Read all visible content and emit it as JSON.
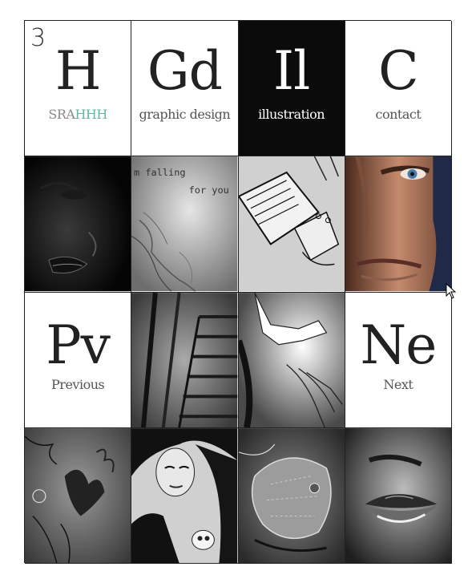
{
  "home_tile": {
    "number": "3",
    "symbol": "H",
    "brand_first": "SRA",
    "brand_second": "HHH"
  },
  "nav": [
    {
      "symbol": "Gd",
      "label": "graphic design"
    },
    {
      "symbol": "Il",
      "label": "illustration"
    },
    {
      "symbol": "C",
      "label": "contact"
    }
  ],
  "pager": {
    "previous": {
      "symbol": "Pv",
      "label": "Previous"
    },
    "next": {
      "symbol": "Ne",
      "label": "Next"
    }
  },
  "artwork_text": {
    "line1": "m falling",
    "line2": "for you"
  },
  "colors": {
    "accent": "#5fb8a2",
    "dark_tile": "#0b0b0c",
    "border": "#222222"
  }
}
